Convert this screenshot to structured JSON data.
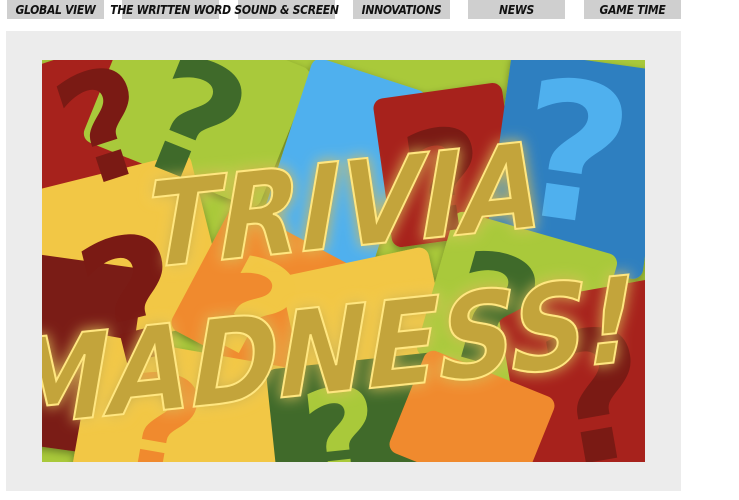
{
  "nav": {
    "items": [
      {
        "label": "Global View"
      },
      {
        "label": "The Written Word"
      },
      {
        "label": "Sound & Screen"
      },
      {
        "label": "Innovations"
      },
      {
        "label": "News"
      },
      {
        "label": "Game Time"
      }
    ]
  },
  "feature": {
    "title_line1": "Trivia",
    "title_line2": "Madness!",
    "colors": {
      "title": "#c3a43a",
      "title_glow": "#ffe680",
      "lime": "#a9c93a",
      "dark_green": "#3f6a2a",
      "red": "#a7241d",
      "dark_red": "#7a1a14",
      "yellow": "#f2c744",
      "orange": "#f08a2e",
      "blue": "#2f7fc0",
      "sky_blue": "#4fb0ee"
    },
    "icons": [
      "question-mark-icon"
    ]
  }
}
